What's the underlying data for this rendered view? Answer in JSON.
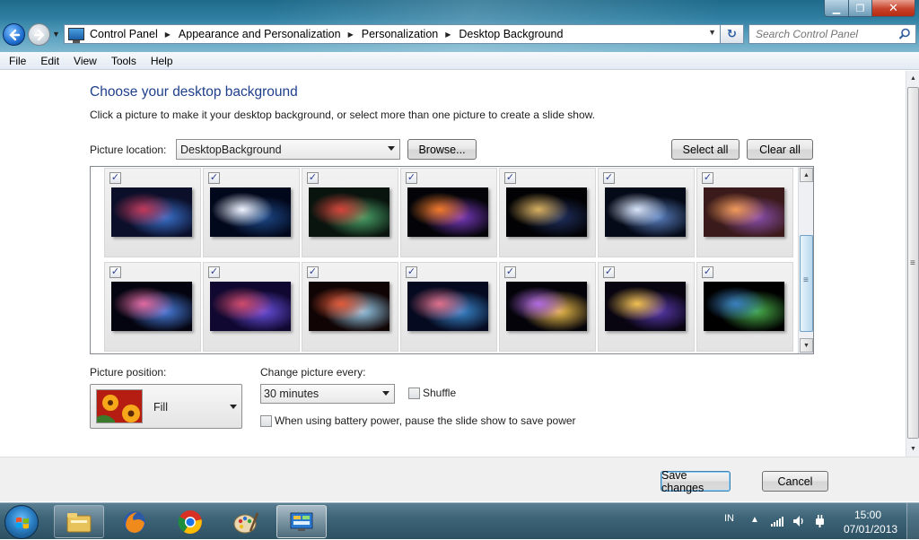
{
  "window": {
    "breadcrumbs": [
      "Control Panel",
      "Appearance and Personalization",
      "Personalization",
      "Desktop Background"
    ],
    "search_placeholder": "Search Control Panel",
    "icons": {
      "back": "back-arrow-icon",
      "forward": "forward-arrow-icon",
      "refresh": "refresh-icon",
      "search": "search-icon",
      "min": "minimize-icon",
      "max": "maximize-icon",
      "close": "close-icon"
    }
  },
  "menu": [
    "File",
    "Edit",
    "View",
    "Tools",
    "Help"
  ],
  "page": {
    "title": "Choose your desktop background",
    "subtitle": "Click a picture to make it your desktop background, or select more than one picture to create a slide show.",
    "picture_location_label": "Picture location:",
    "picture_location_value": "DesktopBackground",
    "browse_label": "Browse...",
    "select_all_label": "Select all",
    "clear_all_label": "Clear all"
  },
  "pictures": {
    "row1": [
      {
        "checked": true,
        "palette": [
          "#0b0f2a",
          "#c0395a",
          "#3a74d0"
        ]
      },
      {
        "checked": true,
        "palette": [
          "#02081c",
          "#f0f4ff",
          "#1d4a8a"
        ]
      },
      {
        "checked": true,
        "palette": [
          "#0a140e",
          "#d4433a",
          "#4aa56a"
        ]
      },
      {
        "checked": true,
        "palette": [
          "#040408",
          "#f07a2a",
          "#7a3ac0"
        ]
      },
      {
        "checked": true,
        "palette": [
          "#020204",
          "#d8b060",
          "#203060"
        ]
      },
      {
        "checked": true,
        "palette": [
          "#050a18",
          "#d8e4f8",
          "#5a80c0"
        ]
      },
      {
        "checked": true,
        "palette": [
          "#3a1a1a",
          "#f09a5a",
          "#8a50b0"
        ]
      }
    ],
    "row2": [
      {
        "checked": true,
        "palette": [
          "#040410",
          "#e06aa0",
          "#4a80e0"
        ]
      },
      {
        "checked": true,
        "palette": [
          "#100830",
          "#d04a6a",
          "#6a50e0"
        ]
      },
      {
        "checked": true,
        "palette": [
          "#100404",
          "#e05a3a",
          "#9ad0f0"
        ]
      },
      {
        "checked": true,
        "palette": [
          "#060a20",
          "#e0708a",
          "#3a8ad0"
        ]
      },
      {
        "checked": true,
        "palette": [
          "#04030a",
          "#b06ae0",
          "#f0c04a"
        ]
      },
      {
        "checked": true,
        "palette": [
          "#080410",
          "#f0c050",
          "#5a3ab0"
        ]
      },
      {
        "checked": true,
        "palette": [
          "#000000",
          "#3a80c0",
          "#4ab04a"
        ]
      }
    ]
  },
  "options": {
    "position_label": "Picture position:",
    "position_value": "Fill",
    "interval_label": "Change picture every:",
    "interval_value": "30 minutes",
    "shuffle_label": "Shuffle",
    "shuffle_checked": false,
    "battery_label": "When using battery power, pause the slide show to save power",
    "battery_checked": false
  },
  "footer": {
    "save_label": "Save changes",
    "cancel_label": "Cancel"
  },
  "taskbar": {
    "apps": [
      "explorer-icon",
      "firefox-icon",
      "chrome-icon",
      "paint-icon",
      "control-panel-icon"
    ],
    "language": "IN",
    "time": "15:00",
    "date": "07/01/2013"
  }
}
